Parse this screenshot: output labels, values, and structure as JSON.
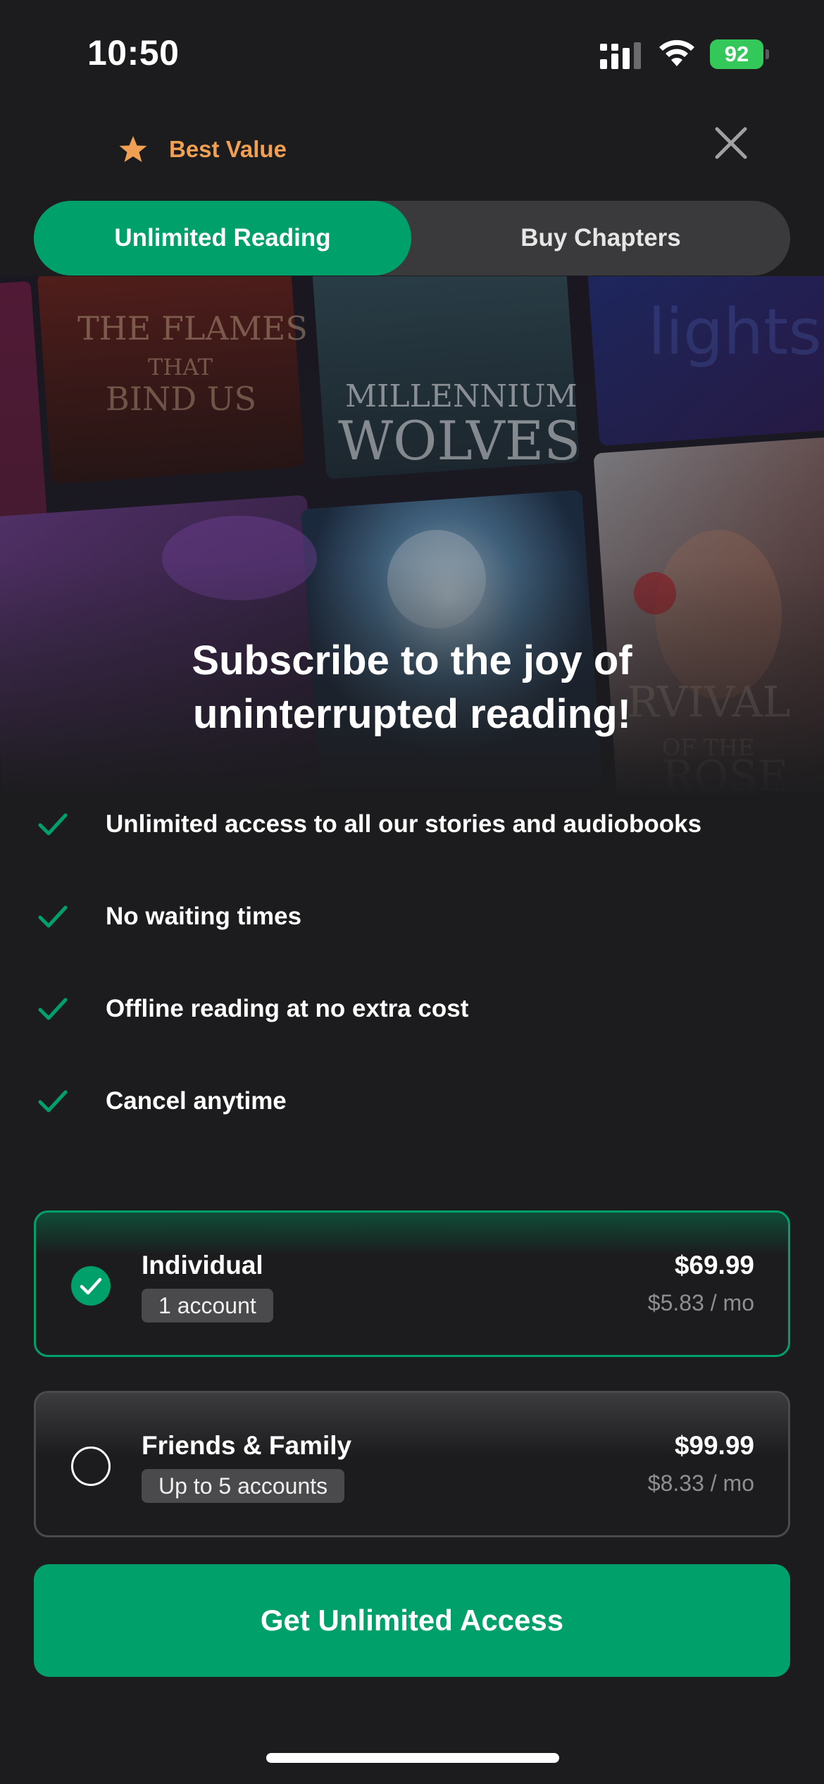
{
  "status_bar": {
    "time": "10:50",
    "battery": "92",
    "icons": [
      "cellular-signal-icon",
      "wifi-icon",
      "battery-charging-icon"
    ]
  },
  "header": {
    "best_value_label": "Best Value",
    "best_value_icon": "star-icon",
    "close_icon": "close-icon"
  },
  "tabs": [
    {
      "label": "Unlimited Reading",
      "active": true
    },
    {
      "label": "Buy Chapters",
      "active": false
    }
  ],
  "hero": {
    "title_line_1": "Subscribe to the joy of",
    "title_line_2": "uninterrupted reading!",
    "book_covers": [
      {
        "title": "THE FLAMES THAT BIND US"
      },
      {
        "title": "THE MILLENNIUM WOLVES"
      },
      {
        "title": "BEAST lights"
      },
      {
        "title": "SURVIVAL OF THE ROSE"
      }
    ]
  },
  "features": [
    {
      "text": "Unlimited access to all our stories and audiobooks"
    },
    {
      "text": "No waiting times"
    },
    {
      "text": "Offline reading at no extra cost"
    },
    {
      "text": "Cancel anytime"
    }
  ],
  "plans": [
    {
      "name": "Individual",
      "badge": "1 account",
      "price": "$69.99",
      "monthly": "$5.83 / mo",
      "selected": true
    },
    {
      "name": "Friends & Family",
      "badge": "Up to 5 accounts",
      "price": "$99.99",
      "monthly": "$8.33 / mo",
      "selected": false
    }
  ],
  "cta": {
    "label": "Get Unlimited Access"
  },
  "colors": {
    "background": "#1c1c1e",
    "accent_green": "#00a06a",
    "best_value_orange": "#f0a052",
    "tab_track": "#3a3a3c",
    "muted_text": "#8e8e93",
    "battery_green": "#34c759"
  }
}
